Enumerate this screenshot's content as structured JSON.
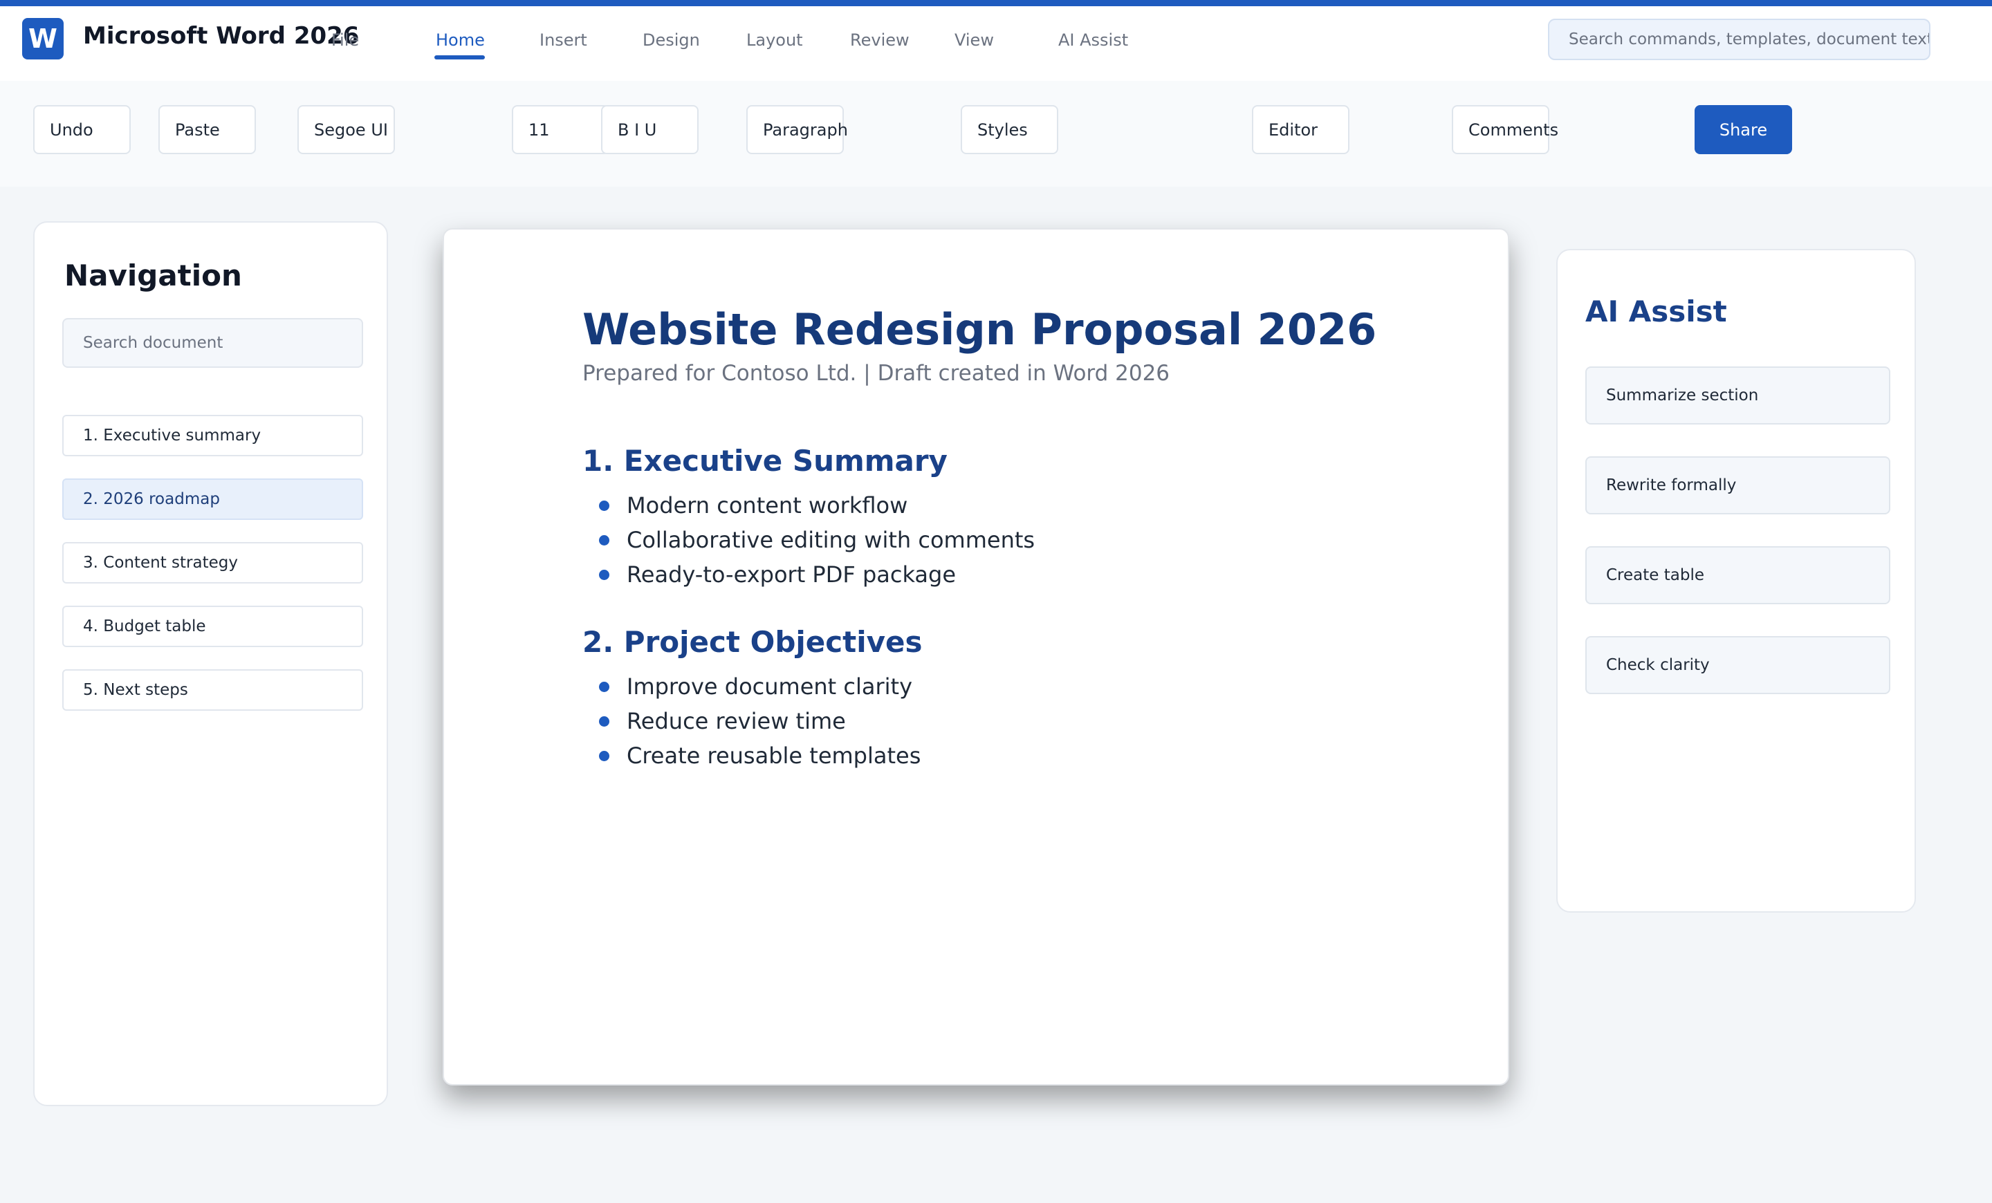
{
  "app": {
    "logo_letter": "W",
    "title": "Microsoft Word 2026",
    "accent_color": "#1e5bbf"
  },
  "menu": {
    "tabs": [
      {
        "label": "File"
      },
      {
        "label": "Home",
        "active": true
      },
      {
        "label": "Insert"
      },
      {
        "label": "Design"
      },
      {
        "label": "Layout"
      },
      {
        "label": "Review"
      },
      {
        "label": "View"
      },
      {
        "label": "AI Assist"
      }
    ]
  },
  "search": {
    "placeholder": "Search commands, templates, document text"
  },
  "ribbon": {
    "undo": "Undo",
    "paste": "Paste",
    "font_family": "Segoe UI",
    "font_size": "11",
    "format": "B  I  U",
    "paragraph": "Paragraph",
    "styles": "Styles",
    "editor": "Editor",
    "comments": "Comments",
    "share": "Share"
  },
  "navigation": {
    "title": "Navigation",
    "search_placeholder": "Search document",
    "items": [
      {
        "label": "1. Executive summary"
      },
      {
        "label": "2. 2026 roadmap",
        "active": true
      },
      {
        "label": "3. Content strategy"
      },
      {
        "label": "4. Budget table"
      },
      {
        "label": "5. Next steps"
      }
    ]
  },
  "document": {
    "title": "Website Redesign Proposal 2026",
    "subtitle": "Prepared for Contoso Ltd. | Draft created in Word 2026",
    "sections": [
      {
        "heading": "1. Executive Summary",
        "bullets": [
          "Modern content workflow",
          "Collaborative editing with comments",
          "Ready-to-export PDF package"
        ]
      },
      {
        "heading": "2. Project Objectives",
        "bullets": [
          "Improve document clarity",
          "Reduce review time",
          "Create reusable templates"
        ]
      }
    ]
  },
  "ai_assist": {
    "title": "AI Assist",
    "actions": [
      {
        "label": "Summarize section"
      },
      {
        "label": "Rewrite formally"
      },
      {
        "label": "Create table"
      },
      {
        "label": "Check clarity"
      }
    ]
  }
}
